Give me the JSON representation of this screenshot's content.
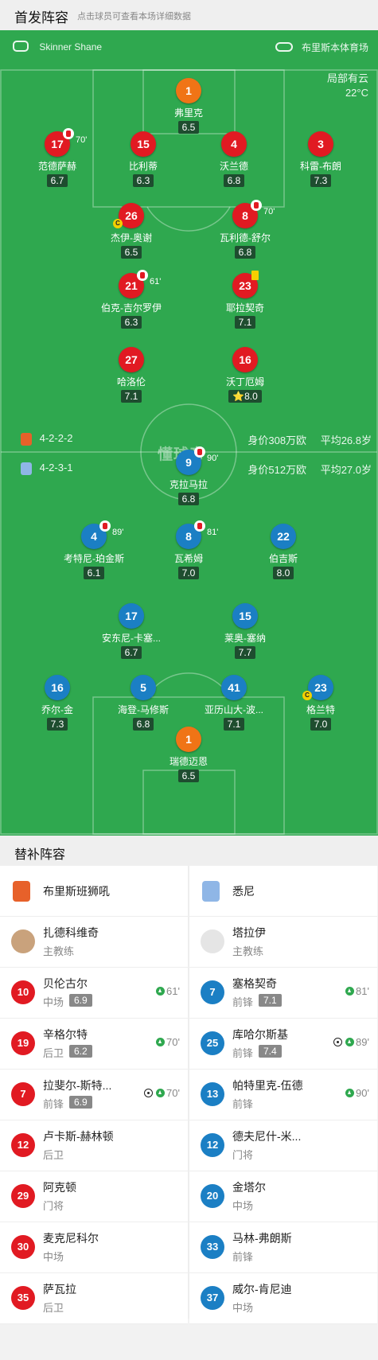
{
  "header": {
    "title": "首发阵容",
    "subtitle": "点击球员可查看本场详细数据"
  },
  "match": {
    "referee": "Skinner Shane",
    "venue": "布里斯本体育场",
    "weather": "局部有云",
    "temperature": "22°C",
    "watermark": "懂球帝"
  },
  "home": {
    "formation": "4-2-2-2",
    "value": "身价308万欧",
    "avg_age": "平均26.8岁",
    "color": "#e11a22",
    "players": [
      {
        "num": "1",
        "name": "弗里克",
        "rating": "6.5",
        "kit": "orange"
      },
      {
        "num": "17",
        "name": "范德萨赫",
        "rating": "6.7",
        "kit": "red",
        "sub": "70'"
      },
      {
        "num": "15",
        "name": "比利蒂",
        "rating": "6.3",
        "kit": "red"
      },
      {
        "num": "4",
        "name": "沃兰德",
        "rating": "6.8",
        "kit": "red"
      },
      {
        "num": "3",
        "name": "科雷-布朗",
        "rating": "7.3",
        "kit": "red"
      },
      {
        "num": "26",
        "name": "杰伊-奥谢",
        "rating": "6.5",
        "kit": "red",
        "captain": "C"
      },
      {
        "num": "8",
        "name": "瓦利德-舒尔",
        "rating": "6.8",
        "kit": "red",
        "sub": "70'"
      },
      {
        "num": "21",
        "name": "伯克-吉尔罗伊",
        "rating": "6.3",
        "kit": "red",
        "sub": "61'"
      },
      {
        "num": "23",
        "name": "耶拉契奇",
        "rating": "7.1",
        "kit": "red",
        "yellow": true
      },
      {
        "num": "27",
        "name": "哈洛伦",
        "rating": "7.1",
        "kit": "red"
      },
      {
        "num": "16",
        "name": "沃丁厄姆",
        "rating": "8.0",
        "kit": "red",
        "star": "⭐"
      }
    ]
  },
  "away": {
    "formation": "4-2-3-1",
    "value": "身价512万欧",
    "avg_age": "平均27.0岁",
    "color": "#1b7fc4",
    "players": [
      {
        "num": "9",
        "name": "克拉马拉",
        "rating": "6.8",
        "kit": "blue",
        "sub": "90'"
      },
      {
        "num": "4",
        "name": "考特尼-珀金斯",
        "rating": "6.1",
        "kit": "blue",
        "sub": "89'"
      },
      {
        "num": "8",
        "name": "瓦希姆",
        "rating": "7.0",
        "kit": "blue",
        "sub": "81'"
      },
      {
        "num": "22",
        "name": "伯吉斯",
        "rating": "8.0",
        "kit": "blue"
      },
      {
        "num": "17",
        "name": "安东尼-卡塞...",
        "rating": "6.7",
        "kit": "blue"
      },
      {
        "num": "15",
        "name": "莱奥-塞纳",
        "rating": "7.7",
        "kit": "blue"
      },
      {
        "num": "16",
        "name": "乔尔-金",
        "rating": "7.3",
        "kit": "blue"
      },
      {
        "num": "5",
        "name": "海登-马修斯",
        "rating": "6.8",
        "kit": "blue"
      },
      {
        "num": "41",
        "name": "亚历山大-波...",
        "rating": "7.1",
        "kit": "blue"
      },
      {
        "num": "23",
        "name": "格兰特",
        "rating": "7.0",
        "kit": "blue",
        "captain": "C"
      },
      {
        "num": "1",
        "name": "瑞德迈恩",
        "rating": "6.5",
        "kit": "orange"
      }
    ]
  },
  "subs": {
    "title": "替补阵容",
    "home_team": "布里斯班狮吼",
    "away_team": "悉尼",
    "home_coach": {
      "name": "扎德科维奇",
      "role": "主教练"
    },
    "away_coach": {
      "name": "塔拉伊",
      "role": "主教练"
    },
    "home": [
      {
        "num": "10",
        "name": "贝伦古尔",
        "pos": "中场",
        "rating": "6.9",
        "minute": "61'"
      },
      {
        "num": "19",
        "name": "辛格尔特",
        "pos": "后卫",
        "rating": "6.2",
        "minute": "70'"
      },
      {
        "num": "7",
        "name": "拉斐尔-斯特...",
        "pos": "前锋",
        "rating": "6.9",
        "minute": "70'",
        "goal": true
      },
      {
        "num": "12",
        "name": "卢卡斯-赫林顿",
        "pos": "后卫"
      },
      {
        "num": "29",
        "name": "阿克顿",
        "pos": "门将"
      },
      {
        "num": "30",
        "name": "麦克尼科尔",
        "pos": "中场"
      },
      {
        "num": "35",
        "name": "萨瓦拉",
        "pos": "后卫"
      }
    ],
    "away": [
      {
        "num": "7",
        "name": "塞格契奇",
        "pos": "前锋",
        "rating": "7.1",
        "minute": "81'"
      },
      {
        "num": "25",
        "name": "库哈尔斯基",
        "pos": "前锋",
        "rating": "7.4",
        "minute": "89'",
        "goal": true
      },
      {
        "num": "13",
        "name": "帕特里克-伍德",
        "pos": "前锋",
        "minute": "90'"
      },
      {
        "num": "12",
        "name": "德夫尼什-米...",
        "pos": "门将"
      },
      {
        "num": "20",
        "name": "金塔尔",
        "pos": "中场"
      },
      {
        "num": "33",
        "name": "马林-弗朗斯",
        "pos": "前锋"
      },
      {
        "num": "37",
        "name": "威尔-肯尼迪",
        "pos": "中场"
      }
    ]
  }
}
